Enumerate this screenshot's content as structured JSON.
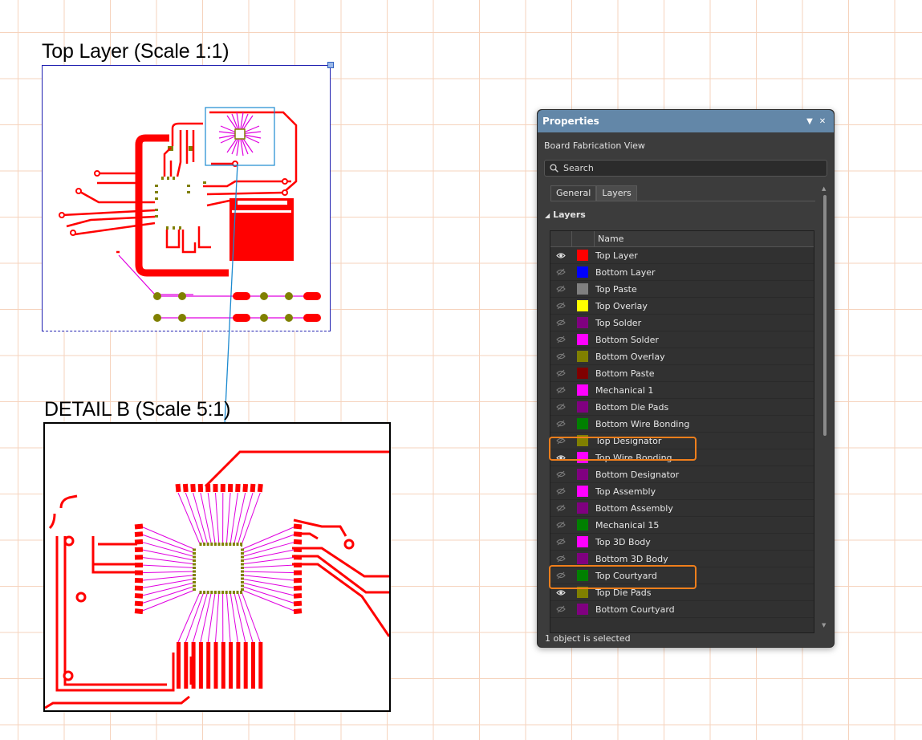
{
  "canvas": {
    "top_view_title": "Top Layer (Scale 1:1)",
    "detail_view_title": "DETAIL B (Scale 5:1)"
  },
  "colors": {
    "trace_red": "#ff0000",
    "wire_magenta": "#e000e0",
    "pad_olive": "#808000",
    "highlight_orange": "#f07f1c",
    "panel_header": "#6387a8"
  },
  "panel": {
    "title": "Properties",
    "subtitle": "Board Fabrication View",
    "search_placeholder": "Search",
    "tabs": [
      {
        "label": "General",
        "active": false
      },
      {
        "label": "Layers",
        "active": true
      }
    ],
    "section_title": "Layers",
    "column_header": "Name",
    "status": "1 object is selected"
  },
  "layers": [
    {
      "name": "Top Layer",
      "color": "#ff0000",
      "visible": true,
      "icon": "eye-icon"
    },
    {
      "name": "Bottom Layer",
      "color": "#0000ff",
      "visible": false,
      "icon": "eye-hidden-icon"
    },
    {
      "name": "Top Paste",
      "color": "#808080",
      "visible": false,
      "icon": "eye-hidden-icon"
    },
    {
      "name": "Top Overlay",
      "color": "#ffff00",
      "visible": false,
      "icon": "eye-hidden-icon"
    },
    {
      "name": "Top Solder",
      "color": "#800080",
      "visible": false,
      "icon": "eye-hidden-icon"
    },
    {
      "name": "Bottom Solder",
      "color": "#ff00ff",
      "visible": false,
      "icon": "eye-hidden-icon"
    },
    {
      "name": "Bottom Overlay",
      "color": "#808000",
      "visible": false,
      "icon": "eye-hidden-icon"
    },
    {
      "name": "Bottom Paste",
      "color": "#800000",
      "visible": false,
      "icon": "eye-hidden-icon"
    },
    {
      "name": "Mechanical 1",
      "color": "#ff00ff",
      "visible": false,
      "icon": "eye-hidden-icon"
    },
    {
      "name": "Bottom Die Pads",
      "color": "#800080",
      "visible": false,
      "icon": "eye-hidden-icon"
    },
    {
      "name": "Bottom Wire Bonding",
      "color": "#008000",
      "visible": false,
      "icon": "eye-hidden-icon"
    },
    {
      "name": "Top Designator",
      "color": "#808000",
      "visible": false,
      "icon": "eye-hidden-icon"
    },
    {
      "name": "Top Wire Bonding",
      "color": "#ff00ff",
      "visible": true,
      "icon": "eye-icon",
      "highlighted": true
    },
    {
      "name": "Bottom Designator",
      "color": "#800080",
      "visible": false,
      "icon": "eye-hidden-icon"
    },
    {
      "name": "Top Assembly",
      "color": "#ff00ff",
      "visible": false,
      "icon": "eye-hidden-icon"
    },
    {
      "name": "Bottom Assembly",
      "color": "#800080",
      "visible": false,
      "icon": "eye-hidden-icon"
    },
    {
      "name": "Mechanical 15",
      "color": "#008000",
      "visible": false,
      "icon": "eye-hidden-icon"
    },
    {
      "name": "Top 3D Body",
      "color": "#ff00ff",
      "visible": false,
      "icon": "eye-hidden-icon"
    },
    {
      "name": "Bottom 3D Body",
      "color": "#800080",
      "visible": false,
      "icon": "eye-hidden-icon"
    },
    {
      "name": "Top Courtyard",
      "color": "#008000",
      "visible": false,
      "icon": "eye-hidden-icon"
    },
    {
      "name": "Top Die Pads",
      "color": "#808000",
      "visible": true,
      "icon": "eye-icon",
      "highlighted": true
    },
    {
      "name": "Bottom Courtyard",
      "color": "#800080",
      "visible": false,
      "icon": "eye-hidden-icon"
    }
  ]
}
